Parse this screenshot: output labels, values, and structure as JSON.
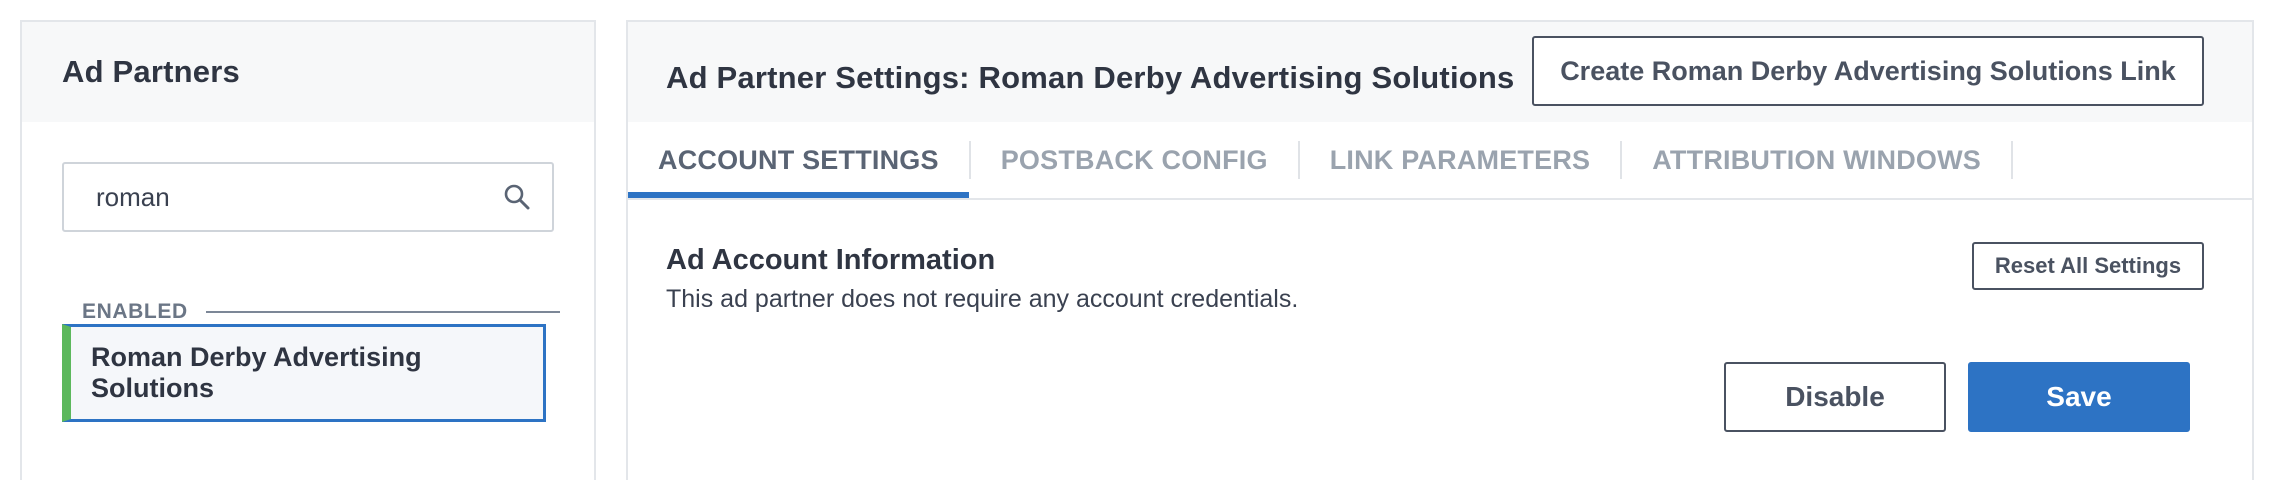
{
  "left_panel": {
    "title": "Ad Partners",
    "search": {
      "value": "roman",
      "icon": "search-icon"
    },
    "section_label": "ENABLED",
    "partners": [
      {
        "name": "Roman Derby Advertising Solutions",
        "status_color": "#5cb85c",
        "selected": true
      }
    ]
  },
  "right_panel": {
    "title": "Ad Partner Settings: Roman Derby Advertising Solutions",
    "create_link_label": "Create Roman Derby Advertising Solutions Link",
    "tabs": [
      {
        "label": "ACCOUNT SETTINGS",
        "active": true
      },
      {
        "label": "POSTBACK CONFIG",
        "active": false
      },
      {
        "label": "LINK PARAMETERS",
        "active": false
      },
      {
        "label": "ATTRIBUTION WINDOWS",
        "active": false
      }
    ],
    "section_title": "Ad Account Information",
    "section_description": "This ad partner does not require any account credentials.",
    "reset_label": "Reset All Settings",
    "disable_label": "Disable",
    "save_label": "Save"
  },
  "colors": {
    "accent": "#2d73c4",
    "enabled_indicator": "#5cb85c",
    "header_bg": "#f7f8f9"
  }
}
